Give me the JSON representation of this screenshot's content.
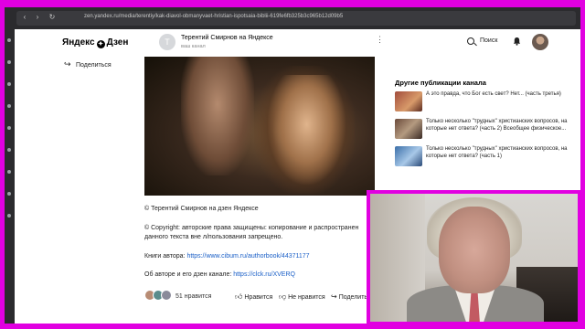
{
  "browser": {
    "url": "zen.yandex.ru/media/terentiy/kak-diavol-obmanyvaet-hristian-ispotsaia-biblii-619fe6fb325b3c965b12d09b5"
  },
  "header": {
    "logo": "Яндекс",
    "logo_suffix": "Дзен",
    "channel_initial": "Т",
    "channel_title": "Терентий Смирнов на Яндексе",
    "channel_subtitle": "ваш канал",
    "search_label": "Поиск"
  },
  "left": {
    "share_label": "Поделиться"
  },
  "article": {
    "copyright_line": "© Терентий Смирнов на дзен Яндексе",
    "rights_line1": "© Copyright: авторские права защищены: копирование и распространен",
    "rights_line2": "данного текста вне л/пользования запрещено.",
    "books_label": "Книги автора:",
    "books_link": "https://www.cibum.ru/authorbook/44371177",
    "about_label": "Об авторе и его дзен канале:",
    "about_link": "https://clck.ru/XVERQ"
  },
  "actions": {
    "likes_count": "51 нравится",
    "like": "Нравится",
    "dislike": "Не нравится",
    "share": "Поделить"
  },
  "sidebar": {
    "title": "Другие публикации канала",
    "items": [
      {
        "text": "А это правда, что Бог есть свет? Нет... (часть третья)"
      },
      {
        "text": "Только несколько \"трудных\" христианских вопросов, на которые нет ответа? (часть 2) Всеобщее физическое..."
      },
      {
        "text": "Только несколько \"трудных\" христианских вопросов, на которые нет ответа? (часть 1)"
      }
    ]
  },
  "colors": {
    "frame": "#e100e1",
    "link": "#1a5fc7"
  }
}
